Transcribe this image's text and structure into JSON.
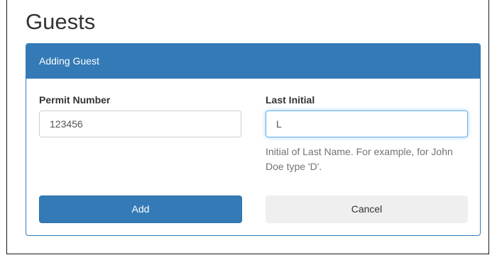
{
  "page": {
    "title": "Guests"
  },
  "panel": {
    "heading": "Adding Guest"
  },
  "form": {
    "permit_number": {
      "label": "Permit Number",
      "value": "123456"
    },
    "last_initial": {
      "label": "Last Initial",
      "value": "L",
      "help": "Initial of Last Name. For example, for John Doe type 'D'."
    }
  },
  "buttons": {
    "add_label": "Add",
    "cancel_label": "Cancel"
  },
  "colors": {
    "primary": "#337ab7",
    "focus_border": "#66afe9",
    "default_button": "#efefef"
  }
}
